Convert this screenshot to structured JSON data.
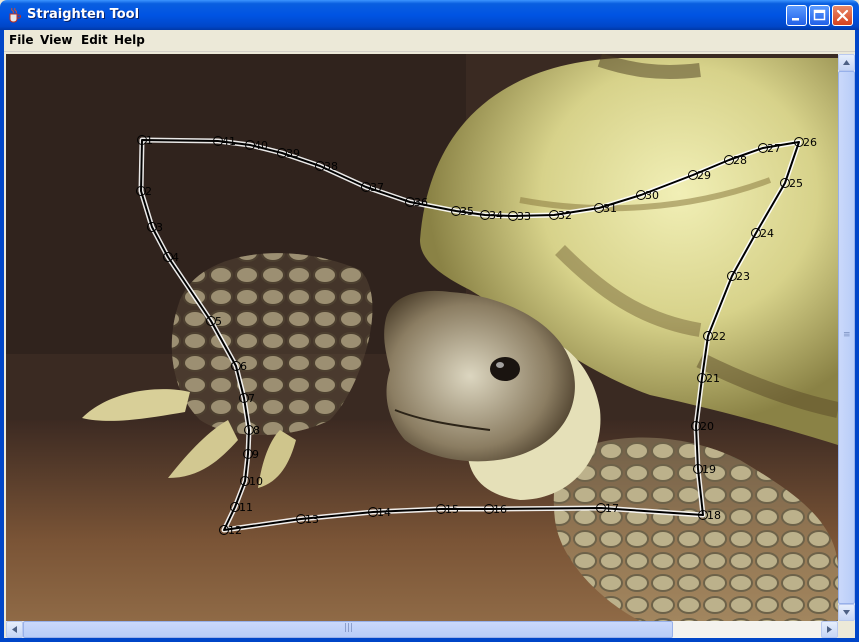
{
  "window": {
    "title": "Straighten Tool"
  },
  "menu": [
    "File",
    "View",
    "Edit",
    "Help"
  ],
  "points": [
    {
      "label": "1"
    },
    {
      "label": "2"
    },
    {
      "label": "3"
    },
    {
      "label": "4"
    },
    {
      "label": "5"
    },
    {
      "label": "6"
    },
    {
      "label": "7"
    },
    {
      "label": "8"
    },
    {
      "label": "9"
    },
    {
      "label": "10"
    },
    {
      "label": "11"
    },
    {
      "label": "12"
    },
    {
      "label": "13"
    },
    {
      "label": "14"
    },
    {
      "label": "15"
    },
    {
      "label": "16"
    },
    {
      "label": "17"
    },
    {
      "label": "18"
    },
    {
      "label": "19"
    },
    {
      "label": "20"
    },
    {
      "label": "21"
    },
    {
      "label": "22"
    },
    {
      "label": "23"
    },
    {
      "label": "24"
    },
    {
      "label": "25"
    },
    {
      "label": "26"
    },
    {
      "label": "27"
    },
    {
      "label": "28"
    },
    {
      "label": "29"
    },
    {
      "label": "30"
    },
    {
      "label": "31"
    },
    {
      "label": "32"
    },
    {
      "label": "33"
    },
    {
      "label": "34"
    },
    {
      "label": "35"
    },
    {
      "label": "36"
    },
    {
      "label": "37"
    },
    {
      "label": "38"
    },
    {
      "label": "39"
    },
    {
      "label": "40"
    },
    {
      "label": "41"
    }
  ],
  "colors": {
    "titlebar": "#0054e3",
    "selection_line": "#000000",
    "halo": "#ffffff"
  },
  "icons": {
    "app": "java-cup-icon",
    "minimize": "minimize-icon",
    "maximize": "maximize-icon",
    "close": "close-icon"
  }
}
